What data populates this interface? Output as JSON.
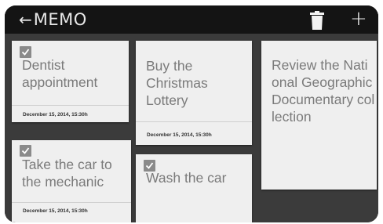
{
  "header": {
    "back_arrow": "←",
    "title": "MEMO",
    "delete_icon": "trash-icon",
    "add_label": "+"
  },
  "colors": {
    "bar": "#141414",
    "board": "#3b3b3b",
    "card": "#efefef",
    "card_text": "#7a7a7a"
  },
  "memos": [
    {
      "text": "Dentist appointment",
      "date": "December 15, 2014, 15:30h",
      "checked": true
    },
    {
      "text": "Take the car to the mechanic",
      "date": "December 15, 2014, 15:30h",
      "checked": true
    },
    {
      "text": "Buy the Christmas Lottery",
      "date": "December 15, 2014, 15:30h",
      "checked": false
    },
    {
      "text": "Wash the car",
      "date": "",
      "checked": true
    },
    {
      "text": "Review the National Geographic Documentary collection",
      "date": "",
      "checked": false
    }
  ]
}
